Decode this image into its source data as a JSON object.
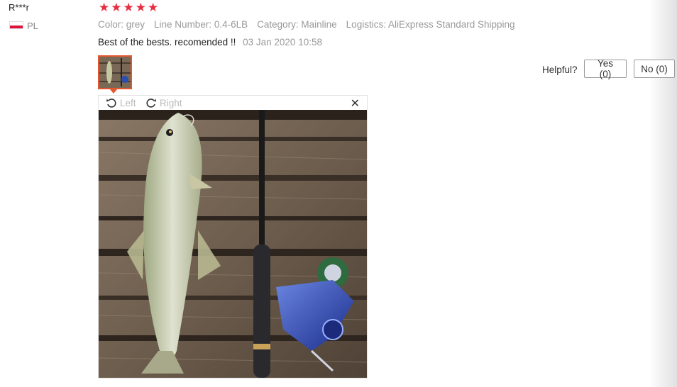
{
  "reviewer": {
    "name": "R***r",
    "country": "PL"
  },
  "rating": {
    "stars": 5,
    "max": 5
  },
  "attributes": [
    "Color: grey",
    "Line Number: 0.4-6LB",
    "Category: Mainline",
    "Logistics: AliExpress Standard Shipping"
  ],
  "review": {
    "text": "Best of the bests. recomended !!",
    "date": "03 Jan 2020 10:58"
  },
  "helpful": {
    "label": "Helpful?",
    "yes_label": "Yes (0)",
    "no_label": "No (0)"
  },
  "viewer": {
    "rotate_left_label": "Left",
    "rotate_right_label": "Right",
    "close_symbol": "✕"
  },
  "colors": {
    "star": "#e62e43",
    "thumb_border": "#e4572e",
    "muted_text": "#999999"
  },
  "icons": [
    "poland-flag-icon",
    "star-icon",
    "rotate-left-icon",
    "rotate-right-icon",
    "close-icon"
  ]
}
